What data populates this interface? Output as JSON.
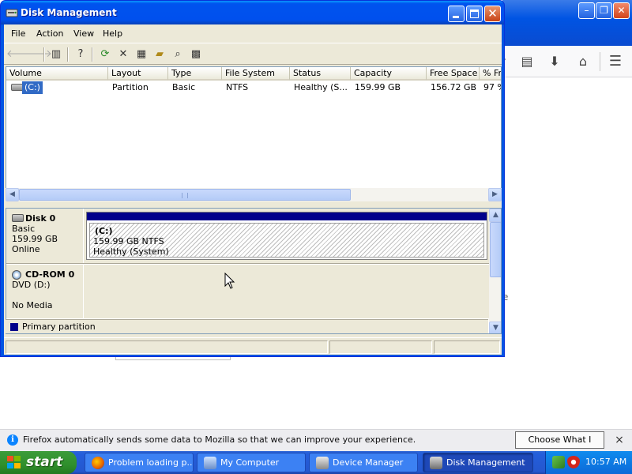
{
  "background_window": {
    "toolbar_icons": [
      "reader-view-icon",
      "download-icon",
      "home-icon",
      "menu-icon"
    ],
    "stray_text": "e"
  },
  "notification": {
    "icon": "info-icon",
    "text": "Firefox automatically sends some data to Mozilla so that we can improve your experience.",
    "button": "Choose What I Share",
    "close": "×"
  },
  "disk_management": {
    "title": "Disk Management",
    "menu": [
      "File",
      "Action",
      "View",
      "Help"
    ],
    "toolbar": [
      "back-icon",
      "forward-icon",
      "show-hide-console-tree-icon",
      "help-icon",
      "refresh-icon",
      "delete-icon",
      "properties-icon",
      "open-icon",
      "rescan-disks-icon",
      "console-tree-icon"
    ],
    "columns": [
      "Volume",
      "Layout",
      "Type",
      "File System",
      "Status",
      "Capacity",
      "Free Space",
      "% Fr"
    ],
    "rows": [
      {
        "volume": "(C:)",
        "layout": "Partition",
        "type": "Basic",
        "file_system": "NTFS",
        "status": "Healthy (S...",
        "capacity": "159.99 GB",
        "free_space": "156.72 GB",
        "pct_free": "97 %"
      }
    ],
    "disks": [
      {
        "name": "Disk 0",
        "kind": "Basic",
        "size": "159.99 GB",
        "state": "Online",
        "partition": {
          "name": "(C:)",
          "detail": "159.99 GB NTFS",
          "status": "Healthy (System)"
        }
      },
      {
        "name": "CD-ROM 0",
        "kind": "DVD (D:)",
        "size": "",
        "state": "No Media"
      }
    ],
    "legend": {
      "label": "Primary partition",
      "color": "#00008b"
    }
  },
  "taskbar": {
    "start": "start",
    "tasks": [
      {
        "label": "Problem loading p...",
        "icon": "firefox-icon",
        "active": false
      },
      {
        "label": "My Computer",
        "icon": "my-computer-icon",
        "active": false
      },
      {
        "label": "Device Manager",
        "icon": "device-manager-icon",
        "active": false
      },
      {
        "label": "Disk Management",
        "icon": "disk-management-icon",
        "active": true
      }
    ],
    "tray_icons": [
      "network-icon",
      "security-shield-icon"
    ],
    "clock": "10:57 AM"
  }
}
